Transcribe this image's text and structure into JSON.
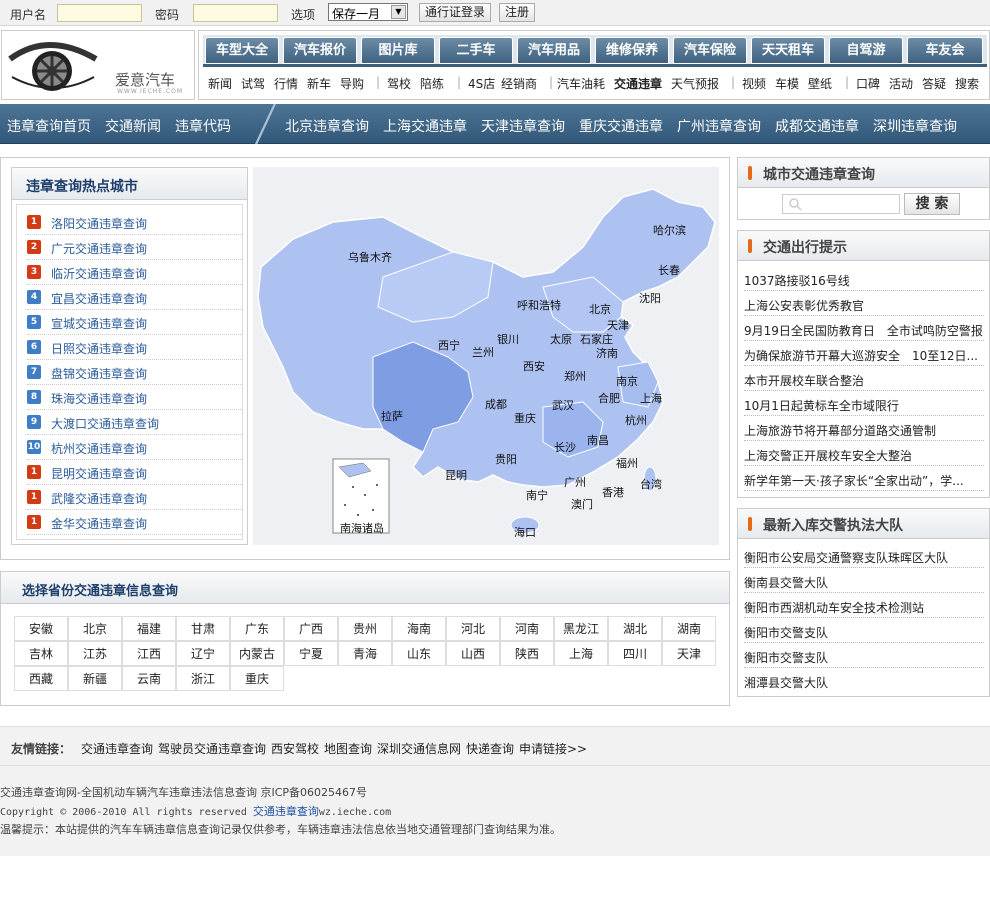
{
  "topbar": {
    "username_label": "用户名",
    "password_label": "密码",
    "options_label": "选项",
    "remember_value": "保存一月",
    "login_button": "通行证登录",
    "register_button": "注册"
  },
  "logo": {
    "brand": "爱意汽车",
    "url": "WWW.IECHE.COM"
  },
  "nav_tabs": [
    "车型大全",
    "汽车报价",
    "图片库",
    "二手车",
    "汽车用品",
    "维修保养",
    "汽车保险",
    "天天租车",
    "自驾游",
    "车友会"
  ],
  "subnav": {
    "group1": [
      "新闻",
      "试驾",
      "行情",
      "新车",
      "导购"
    ],
    "group2": [
      "驾校",
      "陪练"
    ],
    "group3": [
      "4S店",
      "经销商"
    ],
    "group4": [
      "汽车油耗",
      "交通违章",
      "天气预报"
    ],
    "group5": [
      "视频",
      "车模",
      "壁纸"
    ],
    "group6": [
      "口碑",
      "活动",
      "答疑",
      "搜索"
    ]
  },
  "bluebar": {
    "left": [
      "违章查询首页",
      "交通新闻",
      "违章代码"
    ],
    "right": [
      "北京违章查询",
      "上海交通违章",
      "天津违章查询",
      "重庆交通违章",
      "广州违章查询",
      "成都交通违章",
      "深圳违章查询"
    ]
  },
  "hot_cities": {
    "title": "违章查询热点城市",
    "items": [
      {
        "num": "1",
        "text": "洛阳交通违章查询"
      },
      {
        "num": "2",
        "text": "广元交通违章查询"
      },
      {
        "num": "3",
        "text": "临沂交通违章查询"
      },
      {
        "num": "4",
        "text": "宜昌交通违章查询"
      },
      {
        "num": "5",
        "text": "宣城交通违章查询"
      },
      {
        "num": "6",
        "text": "日照交通违章查询"
      },
      {
        "num": "7",
        "text": "盘锦交通违章查询"
      },
      {
        "num": "8",
        "text": "珠海交通违章查询"
      },
      {
        "num": "9",
        "text": "大渡口交通违章查询"
      },
      {
        "num": "10",
        "text": "杭州交通违章查询"
      },
      {
        "num": "1",
        "text": "昆明交通违章查询"
      },
      {
        "num": "1",
        "text": "武隆交通违章查询"
      },
      {
        "num": "1",
        "text": "金华交通违章查询"
      }
    ]
  },
  "map_labels": [
    "乌鲁木齐",
    "哈尔滨",
    "长春",
    "沈阳",
    "呼和浩特",
    "北京",
    "天津",
    "银川",
    "太原",
    "石家庄",
    "济南",
    "西宁",
    "兰州",
    "西安",
    "郑州",
    "南京",
    "合肥",
    "上海",
    "拉萨",
    "成都",
    "武汉",
    "杭州",
    "重庆",
    "长沙",
    "南昌",
    "福州",
    "贵阳",
    "昆明",
    "广州",
    "香港",
    "台湾",
    "南宁",
    "澳门",
    "海口",
    "南海诸岛"
  ],
  "province": {
    "title": "选择省份交通违章信息查询",
    "items": [
      "安徽",
      "北京",
      "福建",
      "甘肃",
      "广东",
      "广西",
      "贵州",
      "海南",
      "河北",
      "河南",
      "黑龙江",
      "湖北",
      "湖南",
      "吉林",
      "江苏",
      "江西",
      "辽宁",
      "内蒙古",
      "宁夏",
      "青海",
      "山东",
      "山西",
      "陕西",
      "上海",
      "四川",
      "天津",
      "西藏",
      "新疆",
      "云南",
      "浙江",
      "重庆"
    ]
  },
  "city_search": {
    "title": "城市交通违章查询",
    "button": "搜 索",
    "placeholder": ""
  },
  "travel_tips": {
    "title": "交通出行提示",
    "items": [
      "1037路接驳16号线",
      "上海公安表彰优秀教官",
      "9月19日全民国防教育日　全市试鸣防空警报",
      "为确保旅游节开幕大巡游安全　10至12日...",
      "本市开展校车联合整治",
      "10月1日起黄标车全市域限行",
      "上海旅游节将开幕部分道路交通管制",
      "上海交警正开展校车安全大整治",
      "新学年第一天·孩子家长“全家出动”，学..."
    ]
  },
  "new_police": {
    "title": "最新入库交警执法大队",
    "items": [
      "衡阳市公安局交通警察支队珠晖区大队",
      "衡南县交警大队",
      "衡阳市西湖机动车安全技术检测站",
      "衡阳市交警支队",
      "衡阳市交警支队",
      "湘潭县交警大队"
    ]
  },
  "friend_links": {
    "label": "友情链接：",
    "items": [
      "交通违章查询",
      "驾驶员交通违章查询",
      "西安驾校",
      "地图查询",
      "深圳交通信息网",
      "快递查询",
      "申请链接>>"
    ]
  },
  "footer": {
    "line1": "交通违章查询网-全国机动车辆汽车违章违法信息查询 京ICP备06025467号",
    "line2a": "Copyright © 2006-2010 All rights reserved ",
    "line2b": "交通违章查询",
    "line2c": "wz.ieche.com",
    "line3": "温馨提示：本站提供的汽车车辆违章信息查询记录仅供参考，车辆违章违法信息依当地交通管理部门查询结果为准。"
  },
  "colors": {
    "nav_blue": "#3e6280",
    "link_blue": "#2a5a99",
    "rank_red": "#d33a16",
    "rank_blue": "#3f7dc4",
    "map_fill": "#aec2f2",
    "accent_orange": "#e46a17"
  }
}
